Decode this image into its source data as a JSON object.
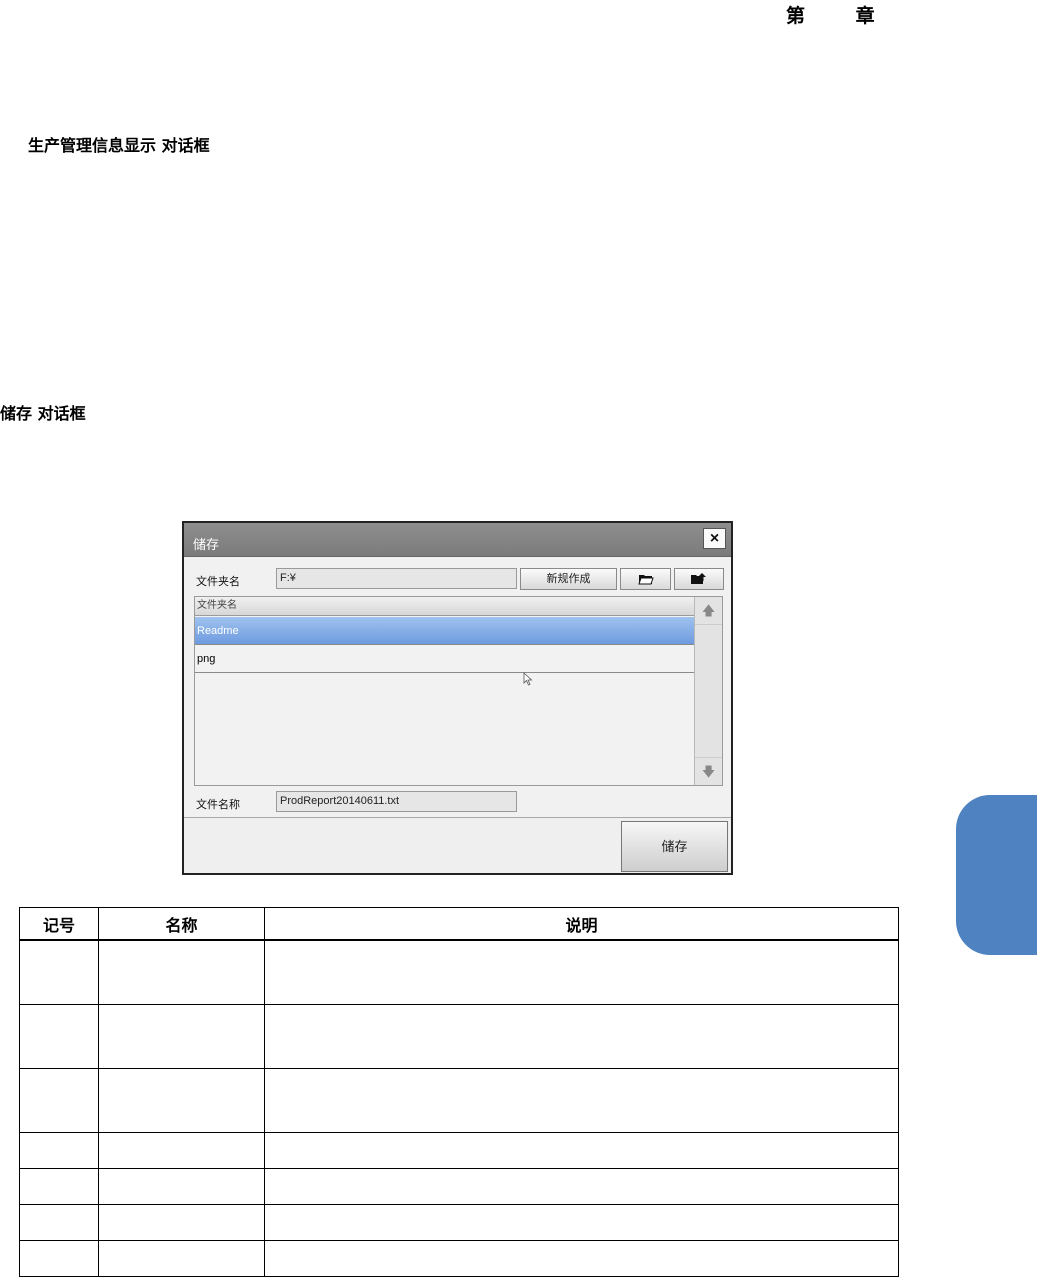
{
  "header": {
    "chapter": "第 章"
  },
  "sections": {
    "section1": "生产管理信息显示 对话框",
    "section2": "储存 对话框"
  },
  "dialog": {
    "title": "储存",
    "close_label": "×",
    "folder_label": "文件夹名",
    "folder_value": "F:¥",
    "new_button": "新规作成",
    "icons": [
      "open-folder-icon",
      "folder-up-icon"
    ],
    "list_header": "文件夹名",
    "rows": [
      {
        "name": "Readme",
        "selected": true
      },
      {
        "name": "png",
        "selected": false
      }
    ],
    "filename_label": "文件名称",
    "filename_value": "ProdReport20140611.txt",
    "save_button": "储存"
  },
  "table": {
    "headers": [
      "记号",
      "名称",
      "说明"
    ],
    "rows": 7
  },
  "colors": {
    "side_tab": "#4f82c0",
    "selection": "#7aa6e6",
    "titlebar": "#858585"
  }
}
